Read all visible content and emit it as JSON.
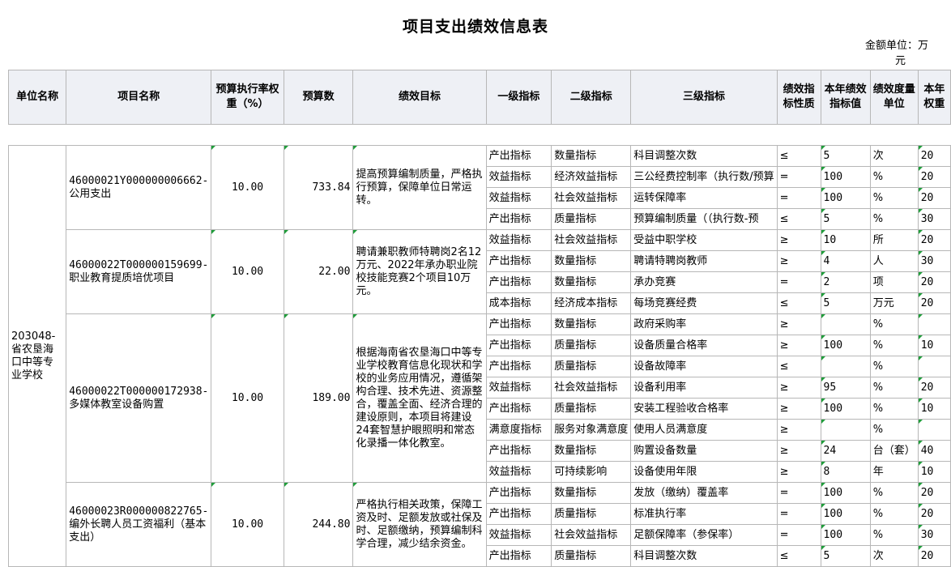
{
  "title": "项目支出绩效信息表",
  "unit_line1": "金额单位：万",
  "unit_line2": "元",
  "headers": [
    "单位名称",
    "项目名称",
    "预算执行率权重（%）",
    "预算数",
    "绩效目标",
    "一级指标",
    "二级指标",
    "三级指标",
    "绩效指标性质",
    "本年绩效指标值",
    "绩效度量单位",
    "本年权重"
  ],
  "unit_name": "203048-省农垦海口中等专业学校",
  "projects": [
    {
      "name": "46000021Y000000006662-公用支出",
      "rate": "10.00",
      "budget": "733.84",
      "goal": "提高预算编制质量，严格执行预算，保障单位日常运转。",
      "rows": [
        {
          "l1": "产出指标",
          "l2": "数量指标",
          "l3": "科目调整次数",
          "nature": "≤",
          "value": "5",
          "unit": "次",
          "weight": "20"
        },
        {
          "l1": "效益指标",
          "l2": "经济效益指标",
          "l3": "三公经费控制率（执行数/预算",
          "nature": "=",
          "value": "100",
          "unit": "%",
          "weight": "20"
        },
        {
          "l1": "效益指标",
          "l2": "社会效益指标",
          "l3": "运转保障率",
          "nature": "=",
          "value": "100",
          "unit": "%",
          "weight": "20"
        },
        {
          "l1": "产出指标",
          "l2": "质量指标",
          "l3": "预算编制质量（（执行数-预",
          "nature": "≤",
          "value": "5",
          "unit": "%",
          "weight": "30"
        }
      ]
    },
    {
      "name": "46000022T000000159699-职业教育提质培优项目",
      "rate": "10.00",
      "budget": "22.00",
      "goal": "聘请兼职教师特聘岗2名12万元、2022年承办职业院校技能竞赛2个项目10万元。",
      "rows": [
        {
          "l1": "效益指标",
          "l2": "社会效益指标",
          "l3": "受益中职学校",
          "nature": "≥",
          "value": "10",
          "unit": "所",
          "weight": "20"
        },
        {
          "l1": "产出指标",
          "l2": "数量指标",
          "l3": "聘请特聘岗教师",
          "nature": "≥",
          "value": "4",
          "unit": "人",
          "weight": "30"
        },
        {
          "l1": "产出指标",
          "l2": "数量指标",
          "l3": "承办竞赛",
          "nature": "=",
          "value": "2",
          "unit": "项",
          "weight": "20"
        },
        {
          "l1": "成本指标",
          "l2": "经济成本指标",
          "l3": "每场竞赛经费",
          "nature": "≤",
          "value": "5",
          "unit": "万元",
          "weight": "20"
        }
      ]
    },
    {
      "name": "46000022T000000172938-多媒体教室设备购置",
      "rate": "10.00",
      "budget": "189.00",
      "goal": "根据海南省农垦海口中等专业学校教育信息化现状和学校的业务应用情况，遵循架构合理、技术先进、资源整合，覆盖全面、经济合理的建设原则，本项目将建设24套智慧护眼照明和常态化录播一体化教室。",
      "rows": [
        {
          "l1": "产出指标",
          "l2": "数量指标",
          "l3": "政府采购率",
          "nature": "≥",
          "value": "",
          "unit": "%",
          "weight": ""
        },
        {
          "l1": "产出指标",
          "l2": "质量指标",
          "l3": "设备质量合格率",
          "nature": "≥",
          "value": "100",
          "unit": "%",
          "weight": "10"
        },
        {
          "l1": "产出指标",
          "l2": "质量指标",
          "l3": "设备故障率",
          "nature": "≤",
          "value": "",
          "unit": "%",
          "weight": ""
        },
        {
          "l1": "效益指标",
          "l2": "社会效益指标",
          "l3": "设备利用率",
          "nature": "≥",
          "value": "95",
          "unit": "%",
          "weight": "20"
        },
        {
          "l1": "产出指标",
          "l2": "质量指标",
          "l3": "安装工程验收合格率",
          "nature": "≥",
          "value": "100",
          "unit": "%",
          "weight": "10"
        },
        {
          "l1": "满意度指标",
          "l2": "服务对象满意度",
          "l3": "使用人员满意度",
          "nature": "≥",
          "value": "",
          "unit": "%",
          "weight": ""
        },
        {
          "l1": "产出指标",
          "l2": "数量指标",
          "l3": "购置设备数量",
          "nature": "≥",
          "value": "24",
          "unit": "台（套）",
          "weight": "40"
        },
        {
          "l1": "效益指标",
          "l2": "可持续影响",
          "l3": "设备使用年限",
          "nature": "≥",
          "value": "8",
          "unit": "年",
          "weight": "10"
        }
      ]
    },
    {
      "name": "46000023R000000822765-编外长聘人员工资福利（基本支出）",
      "rate": "10.00",
      "budget": "244.80",
      "goal": "严格执行相关政策，保障工资及时、足额发放或社保及时、足额缴纳，预算编制科学合理，减少结余资金。",
      "rows": [
        {
          "l1": "产出指标",
          "l2": "数量指标",
          "l3": "发放（缴纳）覆盖率",
          "nature": "=",
          "value": "100",
          "unit": "%",
          "weight": "20"
        },
        {
          "l1": "产出指标",
          "l2": "质量指标",
          "l3": "标准执行率",
          "nature": "=",
          "value": "100",
          "unit": "%",
          "weight": "20"
        },
        {
          "l1": "效益指标",
          "l2": "社会效益指标",
          "l3": "足额保障率（参保率）",
          "nature": "=",
          "value": "100",
          "unit": "%",
          "weight": "30"
        },
        {
          "l1": "产出指标",
          "l2": "质量指标",
          "l3": "科目调整次数",
          "nature": "≤",
          "value": "5",
          "unit": "次",
          "weight": "20"
        }
      ]
    }
  ]
}
